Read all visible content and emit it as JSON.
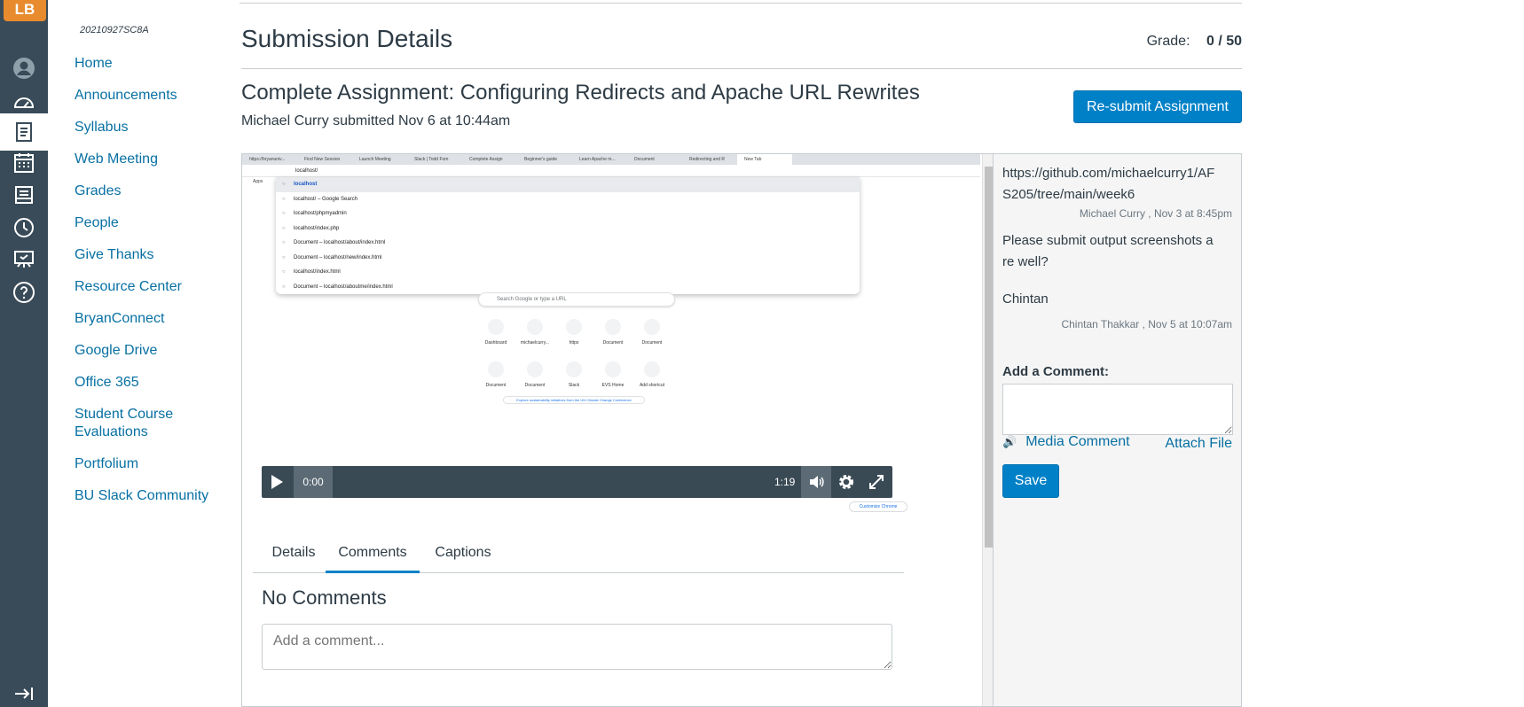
{
  "global_nav": {
    "logo_text": "LB",
    "items": [
      {
        "icon": "user-icon"
      },
      {
        "icon": "dashboard-icon"
      },
      {
        "icon": "courses-icon"
      },
      {
        "icon": "calendar-icon"
      },
      {
        "icon": "inbox-icon"
      },
      {
        "icon": "history-icon"
      },
      {
        "icon": "studio-icon"
      },
      {
        "icon": "help-icon"
      }
    ],
    "collapse_icon": "collapse-nav-icon"
  },
  "course_nav": {
    "course_code": "20210927SC8A",
    "items": [
      "Home",
      "Announcements",
      "Syllabus",
      "Web Meeting",
      "Grades",
      "People",
      "Give Thanks",
      "Resource Center",
      "BryanConnect",
      "Google Drive",
      "Office 365",
      "Student Course Evaluations",
      "Portfolium",
      "BU Slack Community"
    ]
  },
  "header": {
    "title": "Submission Details",
    "grade_label": "Grade:",
    "grade_value": "0 / 50"
  },
  "submission": {
    "assignment_title": "Complete Assignment: Configuring Redirects and Apache URL Rewrites",
    "submitted_by": "Michael Curry submitted Nov 6 at 10:44am",
    "resubmit_label": "Re-submit Assignment"
  },
  "preview": {
    "browser_tabs": [
      "https://bryanuniv...",
      "Find New Session",
      "Launch Meeting",
      "Slack | Todd Fom",
      "Complete Assign",
      "Beginner's guide",
      "Learn Apache m...",
      "Document",
      "Redirecting and R",
      "New Tab"
    ],
    "url_text": "localhost/",
    "bookmarks_text": "Apps",
    "suggestions": [
      "localhost",
      "localhost/ – Google Search",
      "localhost/phpmyadmin",
      "localhost/index.php",
      "Document – localhost/about/index.html",
      "Document – localhost/new/index.html",
      "localhost/index.html",
      "Document – localhost/aboutme/index.html"
    ],
    "search_placeholder": "Search Google or type a URL",
    "shortcuts_row1": [
      "Dashboard",
      "michaelcurry...",
      "https",
      "Document",
      "Document"
    ],
    "shortcuts_row2": [
      "Document",
      "Document",
      "Slack",
      "EVS Home",
      "Add shortcut"
    ],
    "climate_text": "Explore sustainability initiatives from the UN Climate Change Conference",
    "customize_text": "Customize Chrome",
    "video": {
      "current_time": "0:00",
      "total_time": "1:19"
    }
  },
  "tabs": [
    {
      "label": "Details",
      "active": false
    },
    {
      "label": "Comments",
      "active": true
    },
    {
      "label": "Captions",
      "active": false
    }
  ],
  "comments_section": {
    "empty_text": "No Comments",
    "placeholder": "Add a comment..."
  },
  "side_comments": [
    {
      "text": "https://github.com/michaelcurry1/AFS205/tree/main/week6",
      "meta": "Michael Curry , Nov 3 at 8:45pm"
    },
    {
      "text": "Please submit output screenshots are well?",
      "meta": ""
    },
    {
      "text": "Chintan",
      "meta": "Chintan Thakkar , Nov 5 at 10:07am"
    }
  ],
  "add_comment": {
    "label": "Add a Comment:",
    "media_label": "Media Comment",
    "attach_label": "Attach File",
    "save_label": "Save"
  },
  "colors": {
    "global_nav_bg": "#394b58",
    "link": "#0770a3",
    "primary_button": "#0081c7",
    "logo_bg": "#e88b2e"
  }
}
